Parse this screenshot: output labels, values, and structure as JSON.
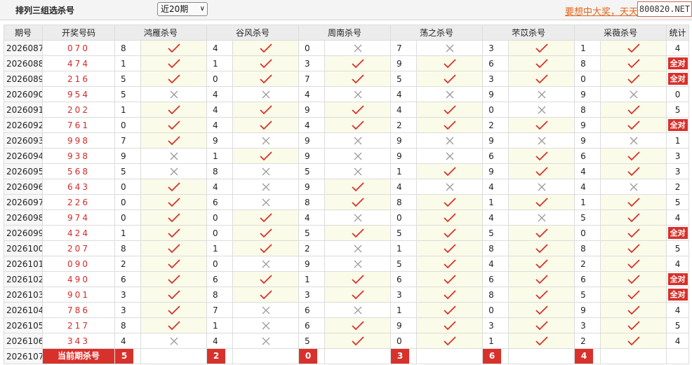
{
  "header": {
    "title": "排列三组选杀号",
    "period_select": "近20期",
    "marquee": "要想中大奖，天天",
    "site": "800820.NET"
  },
  "columns": {
    "issue": "期号",
    "draw": "开奖号码",
    "experts": [
      "鸿雁杀号",
      "谷风杀号",
      "周南杀号",
      "荡之杀号",
      "芣苡杀号",
      "采薇杀号"
    ],
    "stat": "统计"
  },
  "rows": [
    {
      "issue": "2026087",
      "draw": "070",
      "kills": [
        "8",
        "4",
        "0",
        "7",
        "3",
        "1"
      ],
      "ok": [
        true,
        true,
        false,
        false,
        true,
        true
      ],
      "stat": "4"
    },
    {
      "issue": "2026088",
      "draw": "474",
      "kills": [
        "1",
        "1",
        "3",
        "9",
        "6",
        "8"
      ],
      "ok": [
        true,
        true,
        true,
        true,
        true,
        true
      ],
      "stat": "全对"
    },
    {
      "issue": "2026089",
      "draw": "216",
      "kills": [
        "5",
        "0",
        "7",
        "5",
        "3",
        "0"
      ],
      "ok": [
        true,
        true,
        true,
        true,
        true,
        true
      ],
      "stat": "全对"
    },
    {
      "issue": "2026090",
      "draw": "954",
      "kills": [
        "5",
        "4",
        "4",
        "4",
        "9",
        "9"
      ],
      "ok": [
        false,
        false,
        false,
        false,
        false,
        false
      ],
      "stat": "0"
    },
    {
      "issue": "2026091",
      "draw": "202",
      "kills": [
        "1",
        "4",
        "9",
        "4",
        "0",
        "8"
      ],
      "ok": [
        true,
        true,
        true,
        true,
        false,
        true
      ],
      "stat": "5"
    },
    {
      "issue": "2026092",
      "draw": "761",
      "kills": [
        "0",
        "4",
        "4",
        "2",
        "2",
        "9"
      ],
      "ok": [
        true,
        true,
        true,
        true,
        true,
        true
      ],
      "stat": "全对"
    },
    {
      "issue": "2026093",
      "draw": "998",
      "kills": [
        "7",
        "9",
        "9",
        "9",
        "9",
        "9"
      ],
      "ok": [
        true,
        false,
        false,
        false,
        false,
        false
      ],
      "stat": "1"
    },
    {
      "issue": "2026094",
      "draw": "938",
      "kills": [
        "9",
        "1",
        "9",
        "9",
        "6",
        "6"
      ],
      "ok": [
        false,
        true,
        false,
        false,
        true,
        true
      ],
      "stat": "3"
    },
    {
      "issue": "2026095",
      "draw": "568",
      "kills": [
        "5",
        "8",
        "5",
        "1",
        "9",
        "4"
      ],
      "ok": [
        false,
        false,
        false,
        true,
        true,
        true
      ],
      "stat": "3"
    },
    {
      "issue": "2026096",
      "draw": "643",
      "kills": [
        "0",
        "4",
        "9",
        "4",
        "4",
        "4"
      ],
      "ok": [
        true,
        false,
        true,
        false,
        false,
        false
      ],
      "stat": "2"
    },
    {
      "issue": "2026097",
      "draw": "226",
      "kills": [
        "0",
        "6",
        "8",
        "8",
        "1",
        "1"
      ],
      "ok": [
        true,
        false,
        true,
        true,
        true,
        true
      ],
      "stat": "5"
    },
    {
      "issue": "2026098",
      "draw": "974",
      "kills": [
        "0",
        "0",
        "4",
        "0",
        "4",
        "5"
      ],
      "ok": [
        true,
        true,
        false,
        true,
        false,
        true
      ],
      "stat": "4"
    },
    {
      "issue": "2026099",
      "draw": "424",
      "kills": [
        "1",
        "0",
        "5",
        "5",
        "5",
        "0"
      ],
      "ok": [
        true,
        true,
        true,
        true,
        true,
        true
      ],
      "stat": "全对"
    },
    {
      "issue": "2026100",
      "draw": "207",
      "kills": [
        "8",
        "1",
        "2",
        "1",
        "8",
        "8"
      ],
      "ok": [
        true,
        true,
        false,
        true,
        true,
        true
      ],
      "stat": "5"
    },
    {
      "issue": "2026101",
      "draw": "090",
      "kills": [
        "2",
        "0",
        "9",
        "5",
        "4",
        "2"
      ],
      "ok": [
        true,
        false,
        false,
        true,
        true,
        true
      ],
      "stat": "4"
    },
    {
      "issue": "2026102",
      "draw": "490",
      "kills": [
        "6",
        "6",
        "1",
        "6",
        "6",
        "6"
      ],
      "ok": [
        true,
        true,
        true,
        true,
        true,
        true
      ],
      "stat": "全对"
    },
    {
      "issue": "2026103",
      "draw": "901",
      "kills": [
        "3",
        "8",
        "3",
        "3",
        "8",
        "5"
      ],
      "ok": [
        true,
        true,
        true,
        true,
        true,
        true
      ],
      "stat": "全对"
    },
    {
      "issue": "2026104",
      "draw": "786",
      "kills": [
        "3",
        "7",
        "6",
        "1",
        "0",
        "9"
      ],
      "ok": [
        true,
        false,
        false,
        true,
        true,
        true
      ],
      "stat": "4"
    },
    {
      "issue": "2026105",
      "draw": "217",
      "kills": [
        "8",
        "1",
        "6",
        "9",
        "3",
        "3"
      ],
      "ok": [
        true,
        false,
        true,
        true,
        true,
        true
      ],
      "stat": "5"
    },
    {
      "issue": "2026106",
      "draw": "343",
      "kills": [
        "4",
        "4",
        "5",
        "0",
        "1",
        "2"
      ],
      "ok": [
        false,
        false,
        true,
        true,
        true,
        true
      ],
      "stat": "4"
    }
  ],
  "current": {
    "issue": "2026107",
    "label": "当前期杀号",
    "kills": [
      "5",
      "2",
      "0",
      "3",
      "6",
      "4"
    ]
  },
  "colors": {
    "check": "#d8312b",
    "cross": "#9a9a9a",
    "accent": "#d8312b"
  }
}
